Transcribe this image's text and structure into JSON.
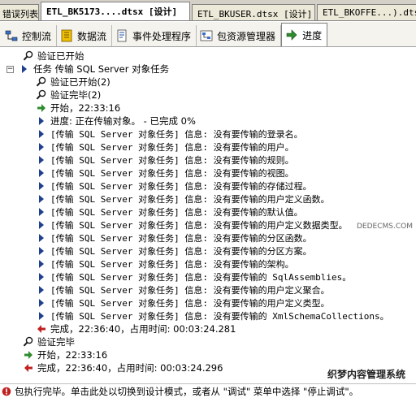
{
  "doc_tabs": [
    {
      "label": "错误列表"
    },
    {
      "label": "ETL_BK5173....dtsx [设计]"
    },
    {
      "label": "ETL_BKUSER.dtsx [设计]"
    },
    {
      "label": "ETL_BKOFFE...).dtsx"
    }
  ],
  "view_tabs": [
    {
      "label": "控制流",
      "icon": "control-flow-icon"
    },
    {
      "label": "数据流",
      "icon": "data-flow-icon"
    },
    {
      "label": "事件处理程序",
      "icon": "event-handler-icon"
    },
    {
      "label": "包资源管理器",
      "icon": "package-explorer-icon"
    },
    {
      "label": "进度",
      "icon": "progress-arrow-icon"
    }
  ],
  "tree": [
    {
      "icon": "search",
      "text": "验证已开始",
      "indent": 28
    },
    {
      "icon": "expander",
      "text": "任务 传输 SQL Server 对象任务",
      "indent": 8
    },
    {
      "icon": "search",
      "text": "验证已开始(2)",
      "indent": 44
    },
    {
      "icon": "search",
      "text": "验证完毕(2)",
      "indent": 44
    },
    {
      "icon": "start",
      "text": "开始，22:33:16",
      "indent": 44
    },
    {
      "icon": "info",
      "text": "进度: 正在传输对象。 - 已完成 0%",
      "indent": 44
    },
    {
      "icon": "info",
      "text": "[传输 SQL Server 对象任务] 信息: 没有要传输的登录名。",
      "indent": 44
    },
    {
      "icon": "info",
      "text": "[传输 SQL Server 对象任务] 信息: 没有要传输的用户。",
      "indent": 44
    },
    {
      "icon": "info",
      "text": "[传输 SQL Server 对象任务] 信息: 没有要传输的规则。",
      "indent": 44
    },
    {
      "icon": "info",
      "text": "[传输 SQL Server 对象任务] 信息: 没有要传输的视图。",
      "indent": 44
    },
    {
      "icon": "info",
      "text": "[传输 SQL Server 对象任务] 信息: 没有要传输的存储过程。",
      "indent": 44
    },
    {
      "icon": "info",
      "text": "[传输 SQL Server 对象任务] 信息: 没有要传输的用户定义函数。",
      "indent": 44
    },
    {
      "icon": "info",
      "text": "[传输 SQL Server 对象任务] 信息: 没有要传输的默认值。",
      "indent": 44
    },
    {
      "icon": "info",
      "text": "[传输 SQL Server 对象任务] 信息: 没有要传输的用户定义数据类型。",
      "indent": 44
    },
    {
      "icon": "info",
      "text": "[传输 SQL Server 对象任务] 信息: 没有要传输的分区函数。",
      "indent": 44
    },
    {
      "icon": "info",
      "text": "[传输 SQL Server 对象任务] 信息: 没有要传输的分区方案。",
      "indent": 44
    },
    {
      "icon": "info",
      "text": "[传输 SQL Server 对象任务] 信息: 没有要传输的架构。",
      "indent": 44
    },
    {
      "icon": "info",
      "text": "[传输 SQL Server 对象任务] 信息: 没有要传输的 SqlAssemblies。",
      "indent": 44
    },
    {
      "icon": "info",
      "text": "[传输 SQL Server 对象任务] 信息: 没有要传输的用户定义聚合。",
      "indent": 44
    },
    {
      "icon": "info",
      "text": "[传输 SQL Server 对象任务] 信息: 没有要传输的用户定义类型。",
      "indent": 44
    },
    {
      "icon": "info",
      "text": "[传输 SQL Server 对象任务] 信息: 没有要传输的 XmlSchemaCollections。",
      "indent": 44
    },
    {
      "icon": "finish",
      "text": "完成，22:36:40，占用时间: 00:03:24.281",
      "indent": 44
    },
    {
      "icon": "search",
      "text": "验证完毕",
      "indent": 28
    },
    {
      "icon": "start",
      "text": "开始，22:33:16",
      "indent": 28
    },
    {
      "icon": "finish",
      "text": "完成，22:36:40，占用时间: 00:03:24.296",
      "indent": 28
    }
  ],
  "status": {
    "text": "包执行完毕。单击此处以切换到设计模式，或者从 \"调试\" 菜单中选择 \"停止调试\"。"
  },
  "watermark": {
    "text": "织梦内容管理系统",
    "small": "DEDECMS.COM"
  },
  "colors": {
    "info_arrow": "#1f3f8f",
    "start_arrow": "#2e8b2e",
    "finish_arrow": "#c02020",
    "search_icon": "#1a1a1a"
  }
}
